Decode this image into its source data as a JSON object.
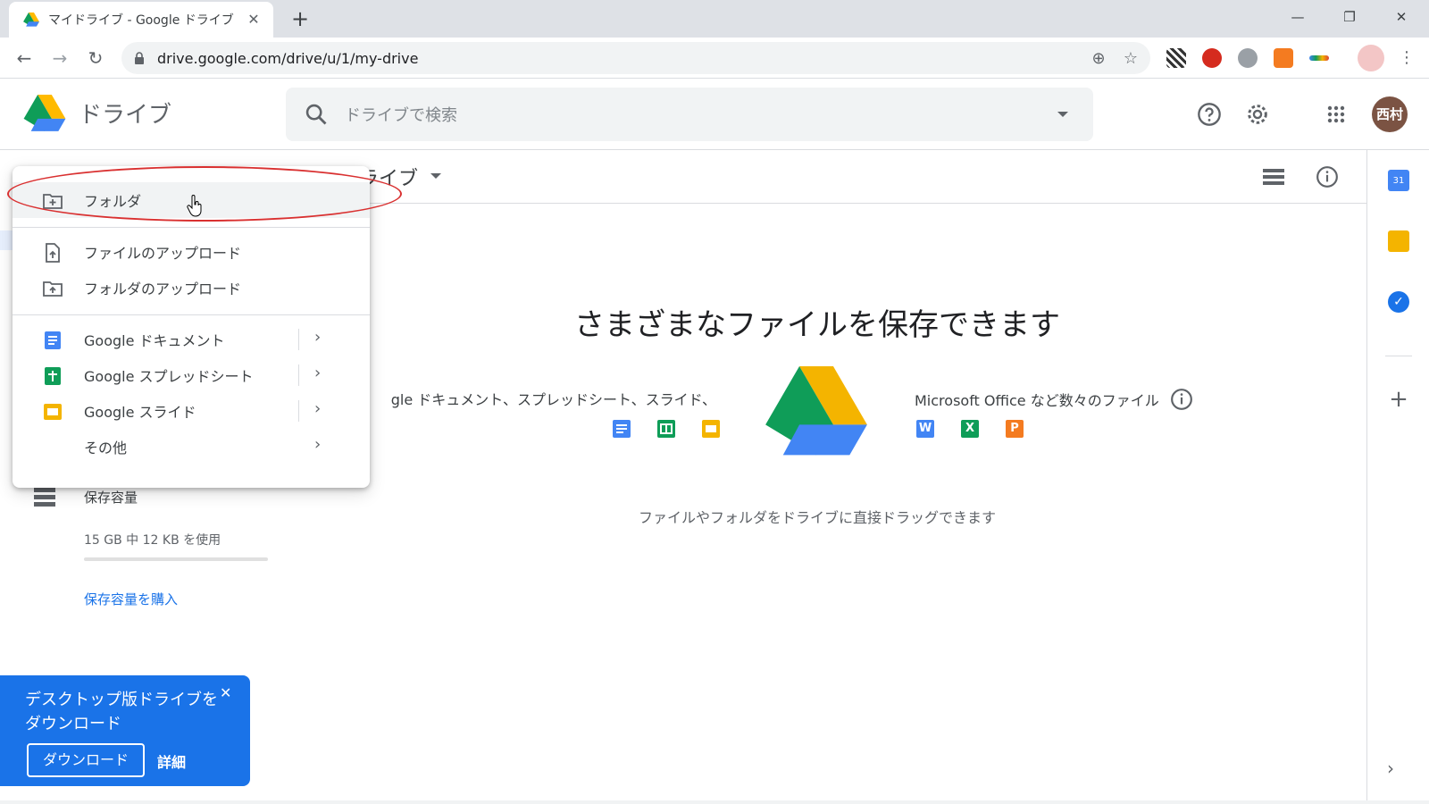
{
  "browser": {
    "tab_title": "マイドライブ - Google ドライブ",
    "url": "drive.google.com/drive/u/1/my-drive",
    "tab_close": "✕",
    "new_tab": "+",
    "window_controls": [
      "—",
      "❐",
      "✕"
    ]
  },
  "header": {
    "brand": "ドライブ",
    "search_placeholder": "ドライブで検索",
    "avatar_text": "西村"
  },
  "breadcrumb": "ライブ",
  "menu": {
    "items": [
      {
        "label": "フォルダ",
        "icon": "new-folder-icon"
      },
      {
        "label": "ファイルのアップロード",
        "icon": "file-upload-icon"
      },
      {
        "label": "フォルダのアップロード",
        "icon": "folder-upload-icon"
      },
      {
        "label": "Google ドキュメント",
        "icon": "docs-icon"
      },
      {
        "label": "Google スプレッドシート",
        "icon": "sheets-icon"
      },
      {
        "label": "Google スライド",
        "icon": "slides-icon"
      },
      {
        "label": "その他",
        "icon": ""
      }
    ]
  },
  "sidebar": {
    "storage_label": "保存容量",
    "storage_usage": "15 GB 中 12 KB を使用",
    "storage_buy": "保存容量を購入"
  },
  "empty_state": {
    "title": "さまざまなファイルを保存できます",
    "left_text": "gle ドキュメント、スプレッドシート、スライド、",
    "right_text": "Microsoft Office など数々のファイル",
    "hint": "ファイルやフォルダをドライブに直接ドラッグできます",
    "office_letters": [
      "W",
      "X",
      "P"
    ]
  },
  "promo": {
    "text": "デスクトップ版ドライブをダウンロード",
    "download_label": "ダウンロード",
    "more_label": "詳細",
    "close": "✕"
  },
  "colors": {
    "accent": "#1a73e8",
    "docs": "#4285f4",
    "sheets": "#0f9d58",
    "slides": "#f4b400",
    "annotation": "#d93030"
  }
}
